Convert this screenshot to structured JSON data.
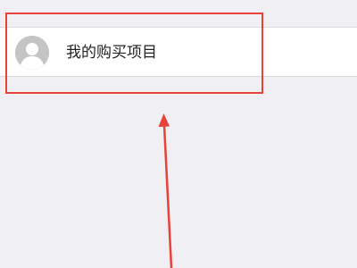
{
  "purchases_item": {
    "label": "我的购买项目",
    "avatar_icon": "default-user-avatar-icon"
  },
  "annotation": {
    "box_color": "#e8423b",
    "arrow_color": "#e8423b"
  }
}
